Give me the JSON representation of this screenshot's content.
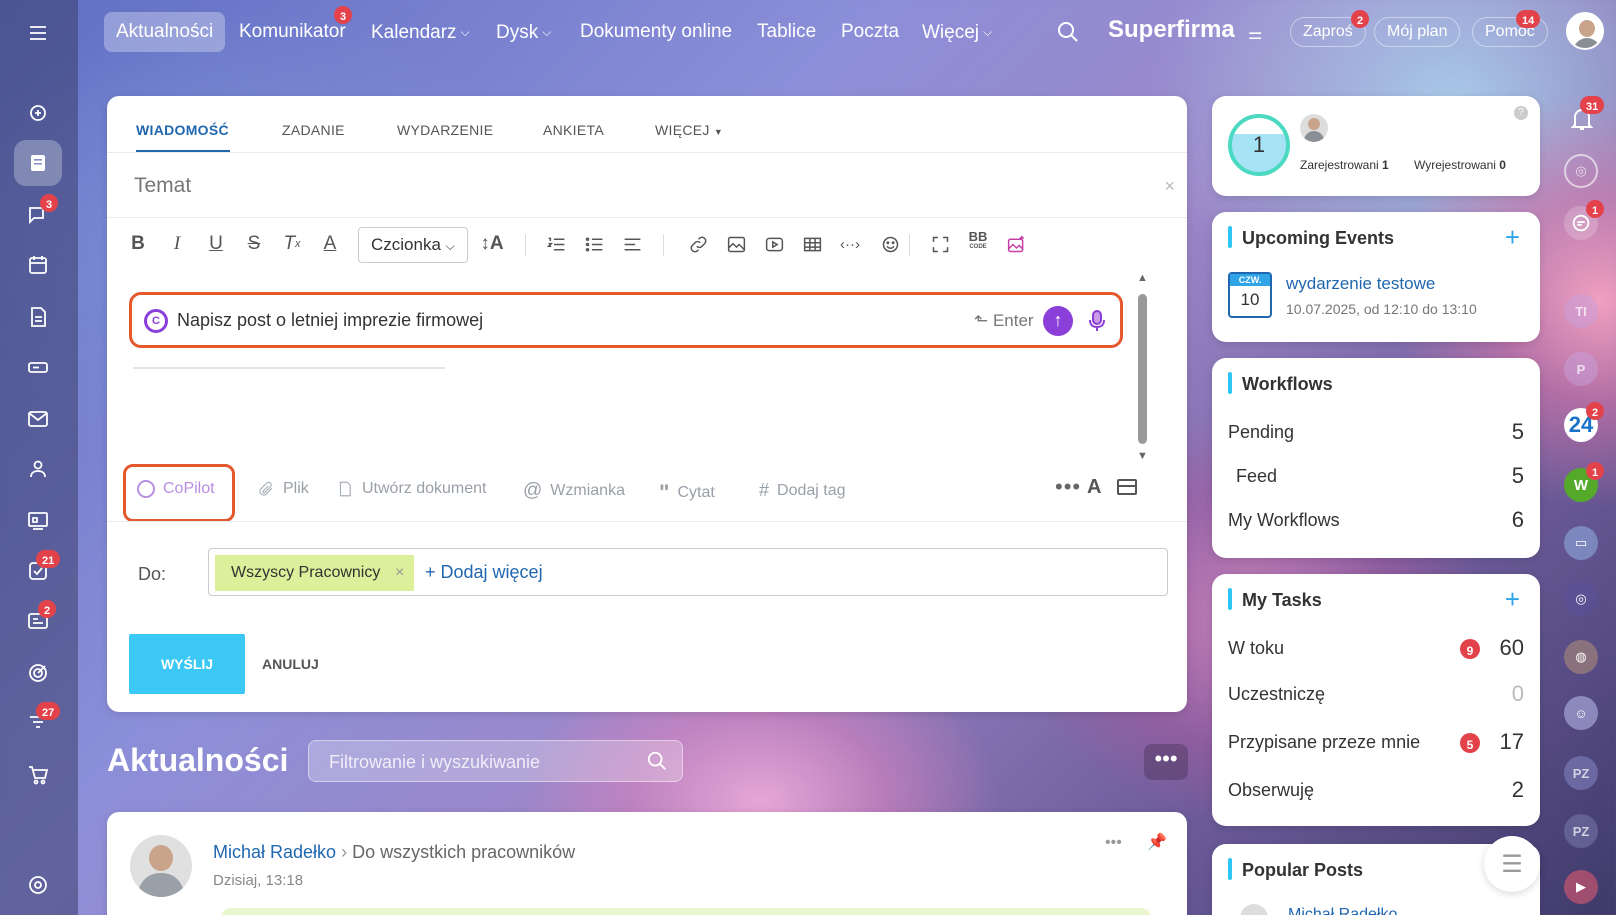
{
  "topnav": {
    "items": [
      {
        "label": "Aktualności"
      },
      {
        "label": "Komunikator",
        "badge": "3"
      },
      {
        "label": "Kalendarz"
      },
      {
        "label": "Dysk"
      },
      {
        "label": "Dokumenty online"
      },
      {
        "label": "Tablice"
      },
      {
        "label": "Poczta"
      },
      {
        "label": "Więcej"
      }
    ],
    "company": "Superfirma",
    "invite": "Zaproś",
    "invite_badge": "2",
    "plan": "Mój plan",
    "help": "Pomoc",
    "help_badge": "14"
  },
  "leftbar": {
    "badges": {
      "chat": "3",
      "tasks": "21",
      "crm": "2",
      "projects": "27"
    }
  },
  "composer": {
    "tabs": [
      "WIADOMOŚĆ",
      "ZADANIE",
      "WYDARZENIE",
      "ANKIETA",
      "WIĘCEJ"
    ],
    "subject_placeholder": "Temat",
    "font_label": "Czcionka",
    "copilot_prompt": "Napisz post o letniej imprezie firmowej",
    "enter_label": "Enter",
    "attachments": {
      "copilot": "CoPilot",
      "file": "Plik",
      "create_doc": "Utwórz dokument",
      "mention": "Wzmianka",
      "quote": "Cytat",
      "tag": "Dodaj tag"
    },
    "to_label": "Do:",
    "recipient": "Wszyscy Pracownicy",
    "add_more": "+ Dodaj więcej",
    "send": "WYŚLIJ",
    "cancel": "ANULUJ"
  },
  "feed": {
    "title": "Aktualności",
    "search_placeholder": "Filtrowanie i wyszukiwanie",
    "post": {
      "author": "Michał Radełko",
      "audience": "Do wszystkich pracowników",
      "time": "Dzisiaj, 13:18"
    }
  },
  "stats": {
    "count": "1",
    "registered_label": "Zarejestrowani",
    "registered": "1",
    "unregistered_label": "Wyrejestrowani",
    "unregistered": "0"
  },
  "events": {
    "title": "Upcoming Events",
    "day_name": "CZW.",
    "day": "10",
    "event_title": "wydarzenie testowe",
    "event_time": "10.07.2025, od 12:10 do 13:10"
  },
  "workflows": {
    "title": "Workflows",
    "rows": [
      {
        "label": "Pending",
        "value": "5"
      },
      {
        "label": "Feed",
        "value": "5"
      },
      {
        "label": "My Workflows",
        "value": "6"
      }
    ]
  },
  "tasks": {
    "title": "My Tasks",
    "rows": [
      {
        "label": "W toku",
        "badge": "9",
        "value": "60"
      },
      {
        "label": "Uczestniczę",
        "value": "0"
      },
      {
        "label": "Przypisane przeze mnie",
        "badge": "5",
        "value": "17"
      },
      {
        "label": "Obserwuję",
        "value": "2"
      }
    ]
  },
  "popular": {
    "title": "Popular Posts",
    "author": "Michał Radełko"
  },
  "rightbar": {
    "notif_badge": "31",
    "chat_badge": "1",
    "b24_label": "24",
    "b24_badge": "2",
    "w_label": "W",
    "w_badge": "1",
    "avatars": [
      "TI",
      "P",
      "PZ",
      "PZ"
    ]
  }
}
